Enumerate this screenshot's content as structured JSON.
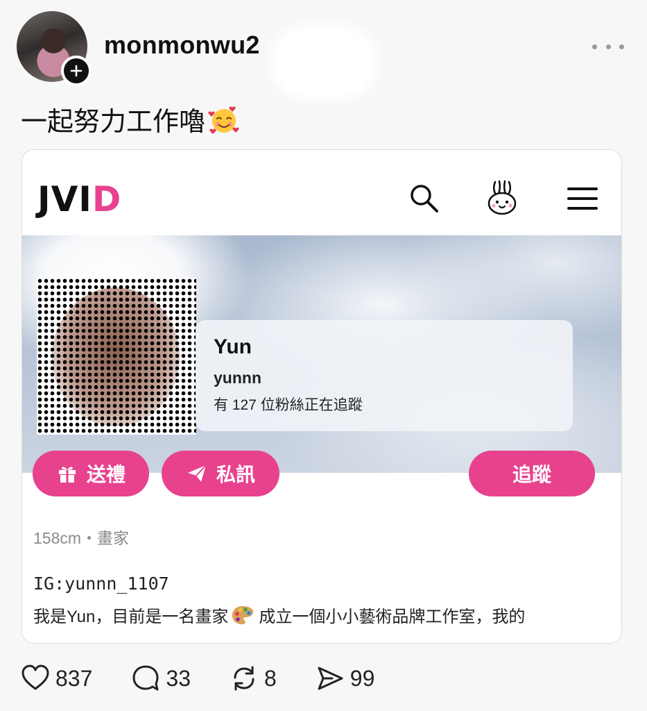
{
  "post": {
    "username": "monmonwu2",
    "text": "一起努力工作嚕",
    "emoji": "smiling-face-with-hearts-icon"
  },
  "card": {
    "logo": {
      "part1": "JVI",
      "part2": "D"
    },
    "profile": {
      "name": "Yun",
      "handle": "yunnn",
      "followers": "有 127 位粉絲正在追蹤"
    },
    "buttons": {
      "gift": "送禮",
      "message": "私訊",
      "follow": "追蹤"
    },
    "meta": "158cm・畫家",
    "ig": "IG:yunnn_1107",
    "bio_part1": "我是Yun，目前是一名畫家",
    "bio_part2": "成立一個小小藝術品牌工作室，我的"
  },
  "actions": {
    "likes": "837",
    "comments": "33",
    "reposts": "8",
    "shares": "99"
  },
  "colors": {
    "brand_pink": "#e8428e",
    "text": "#111111",
    "muted": "#8a8a8a"
  }
}
